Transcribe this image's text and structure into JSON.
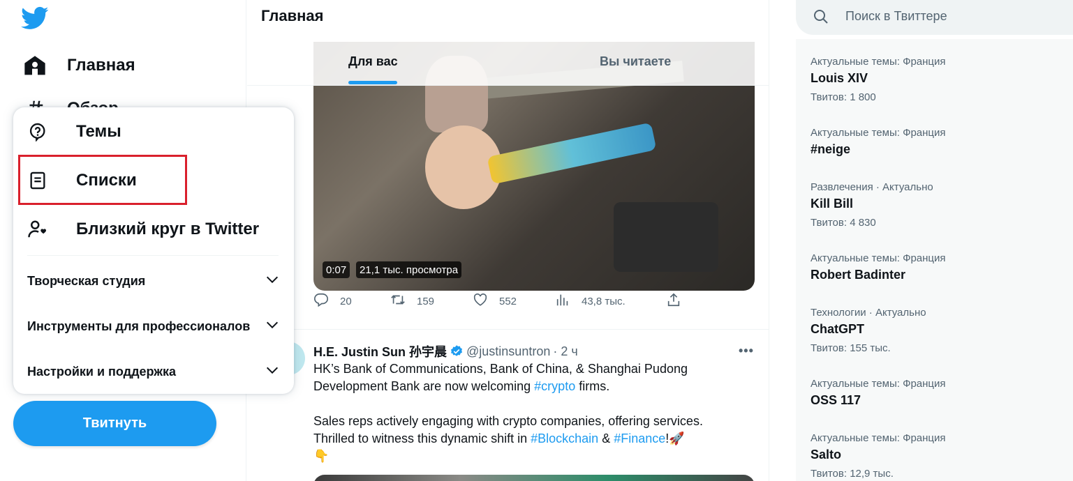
{
  "colors": {
    "accent": "#1d9bf0",
    "text_primary": "#0f1419",
    "text_secondary": "#536471",
    "highlight_box": "#d9202c"
  },
  "sidebar": {
    "logo_icon": "twitter-bird-icon",
    "items": [
      {
        "label": "Главная",
        "icon": "home-icon"
      },
      {
        "label": "Обзор",
        "icon": "hashtag-icon"
      }
    ],
    "tweet_button": "Твитнуть"
  },
  "more_menu": {
    "items": [
      {
        "label": "Темы",
        "icon": "topics-icon"
      },
      {
        "label": "Списки",
        "icon": "lists-icon"
      },
      {
        "label": "Близкий круг в Twitter",
        "icon": "circle-icon"
      }
    ],
    "sections": [
      {
        "label": "Творческая студия"
      },
      {
        "label": "Инструменты для профессионалов"
      },
      {
        "label": "Настройки и поддержка"
      }
    ]
  },
  "feed": {
    "title": "Главная",
    "tabs": [
      {
        "label": "Для вас",
        "active": true
      },
      {
        "label": "Вы читаете",
        "active": false
      }
    ],
    "video_tweet": {
      "duration": "0:07",
      "views_badge": "21,1 тыс. просмотра",
      "replies": "20",
      "retweets": "159",
      "likes": "552",
      "views": "43,8 тыс."
    },
    "tweet2": {
      "name": "H.E. Justin Sun 孙宇晨",
      "handle": "@justinsuntron",
      "time": "· 2 ч",
      "line1": "HK’s Bank of Communications, Bank of China, & Shanghai Pudong",
      "line2_a": "Development Bank are now welcoming ",
      "hashtag_crypto": "#crypto",
      "line2_b": " firms.",
      "line3": "Sales reps actively engaging with crypto companies, offering services.",
      "line4_a": "Thrilled to witness this dynamic shift in ",
      "hashtag_blockchain": "#Blockchain",
      "line4_b": " & ",
      "hashtag_finance": "#Finance",
      "line4_c": "!🚀",
      "line5": "👇"
    }
  },
  "search": {
    "placeholder": "Поиск в Твиттере"
  },
  "trends": [
    {
      "context": "Актуальные темы: Франция",
      "name": "Louis XIV",
      "count": "Твитов: 1 800"
    },
    {
      "context": "Актуальные темы: Франция",
      "name": "#neige",
      "count": ""
    },
    {
      "context": "Развлечения · Актуально",
      "name": "Kill Bill",
      "count": "Твитов: 4 830"
    },
    {
      "context": "Актуальные темы: Франция",
      "name": "Robert Badinter",
      "count": ""
    },
    {
      "context": "Технологии · Актуально",
      "name": "ChatGPT",
      "count": "Твитов: 155 тыс."
    },
    {
      "context": "Актуальные темы: Франция",
      "name": "OSS 117",
      "count": ""
    },
    {
      "context": "Актуальные темы: Франция",
      "name": "Salto",
      "count": "Твитов: 12,9 тыс."
    }
  ]
}
